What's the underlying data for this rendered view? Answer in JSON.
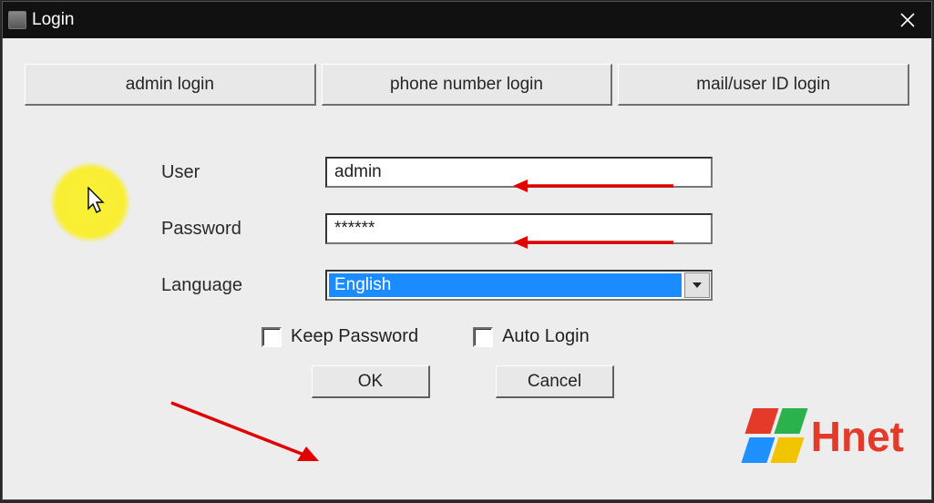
{
  "window": {
    "title": "Login"
  },
  "tabs": {
    "admin": "admin login",
    "phone": "phone number login",
    "mail": "mail/user ID login"
  },
  "form": {
    "user_label": "User",
    "user_value": "admin",
    "password_label": "Password",
    "password_value": "******",
    "language_label": "Language",
    "language_value": "English"
  },
  "checks": {
    "keep_password": "Keep Password",
    "auto_login": "Auto Login"
  },
  "actions": {
    "ok": "OK",
    "cancel": "Cancel"
  },
  "logo": {
    "text": "Hnet"
  }
}
